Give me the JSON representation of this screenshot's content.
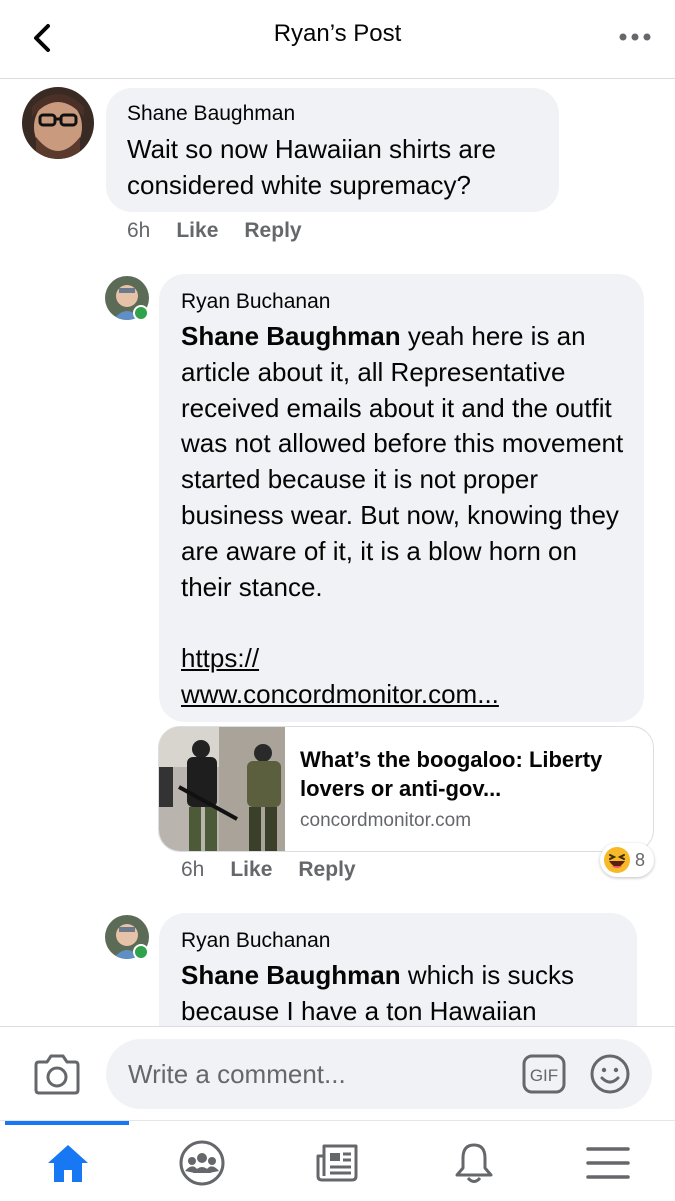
{
  "header": {
    "title": "Ryan’s Post",
    "back_icon": "chevron-left-icon",
    "more_icon": "more-dots-icon"
  },
  "comments": [
    {
      "author": "Shane Baughman",
      "text": "Wait so now Hawaiian shirts are considered white supremacy?",
      "time": "6h",
      "like": "Like",
      "reply": "Reply"
    },
    {
      "author": "Ryan Buchanan",
      "mention": "Shane Baughman",
      "text": " yeah here is an article about it, all Representative received emails about it and the outfit was not allowed before this movement started because it is not proper business wear. But now, knowing they are aware of it, it is a blow horn on their stance.",
      "link_line1": "https://",
      "link_line2": "www.concordmonitor.com...",
      "preview": {
        "title": "What’s the boogaloo: Liberty lovers or anti-gov...",
        "domain": "concordmonitor.com"
      },
      "reaction_count": "8",
      "reaction_icon": "laughing-emoji-icon",
      "time": "6h",
      "like": "Like",
      "reply": "Reply"
    },
    {
      "author": "Ryan Buchanan",
      "mention": "Shane Baughman",
      "text": " which is sucks because I have a ton Hawaiian"
    }
  ],
  "composer": {
    "placeholder": "Write a comment...",
    "gif_label": "GIF"
  },
  "nav": {
    "items": [
      "home-icon",
      "groups-icon",
      "news-feed-icon",
      "notifications-bell-icon",
      "menu-icon"
    ],
    "active_color": "#1877f2"
  }
}
